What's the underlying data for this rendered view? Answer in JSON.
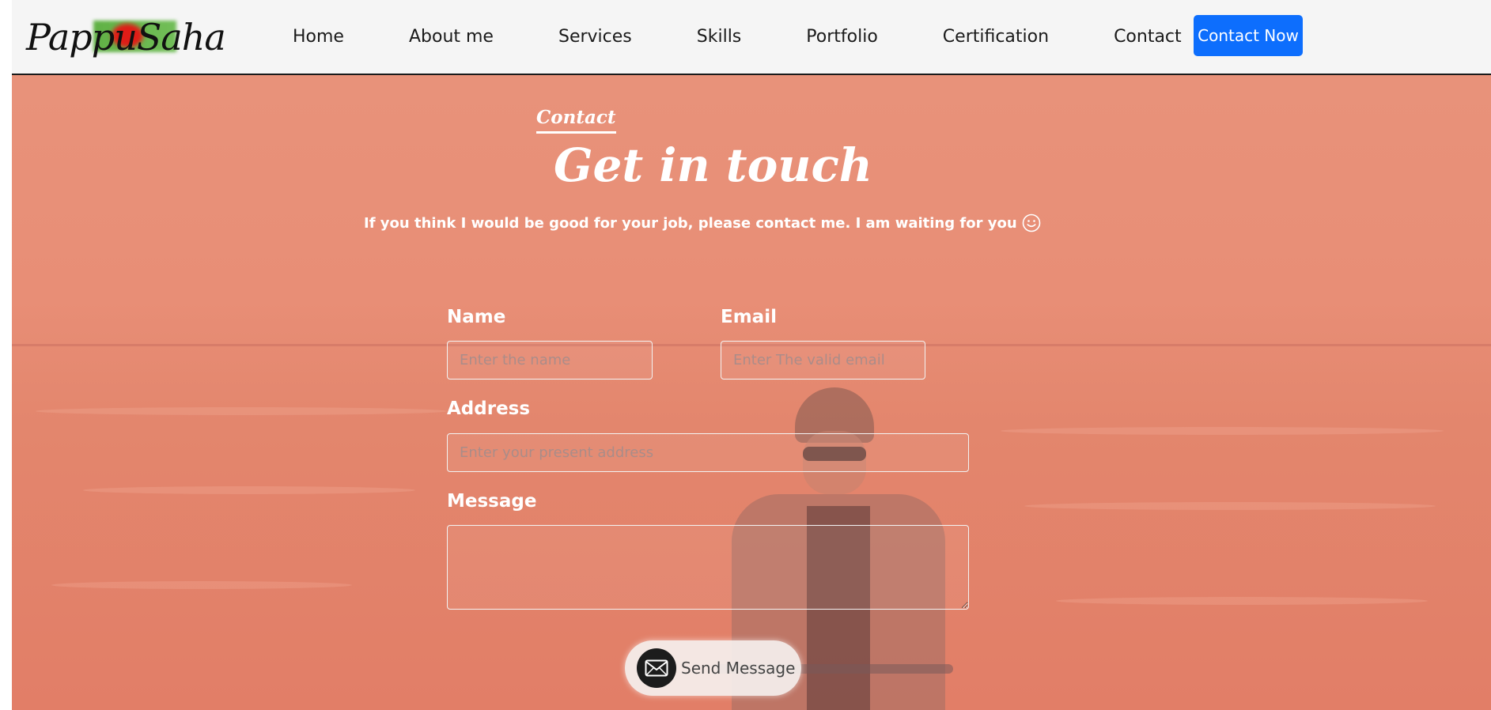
{
  "brand": {
    "logo_text": "PappuSaha"
  },
  "nav": {
    "items": [
      {
        "label": "Home"
      },
      {
        "label": "About me"
      },
      {
        "label": "Services"
      },
      {
        "label": "Skills"
      },
      {
        "label": "Portfolio"
      },
      {
        "label": "Certification"
      },
      {
        "label": "Contact"
      }
    ],
    "cta_label": "Contact Now"
  },
  "hero": {
    "eyebrow": "Contact",
    "headline": "Get in touch",
    "subtitle": "If you think I would be good for your job, please contact me. I am waiting for you"
  },
  "form": {
    "name": {
      "label": "Name",
      "placeholder": "Enter the name",
      "value": ""
    },
    "email": {
      "label": "Email",
      "placeholder": "Enter The valid email",
      "value": ""
    },
    "address": {
      "label": "Address",
      "placeholder": "Enter your present address",
      "value": ""
    },
    "message": {
      "label": "Message",
      "value": ""
    },
    "send_label": "Send Message"
  },
  "colors": {
    "accent": "#0d6efd",
    "overlay": "#e8927a",
    "button_icon_bg": "#1c1c1c"
  },
  "icons": {
    "subtitle_icon": "smile-icon",
    "send_icon": "envelope-icon"
  }
}
